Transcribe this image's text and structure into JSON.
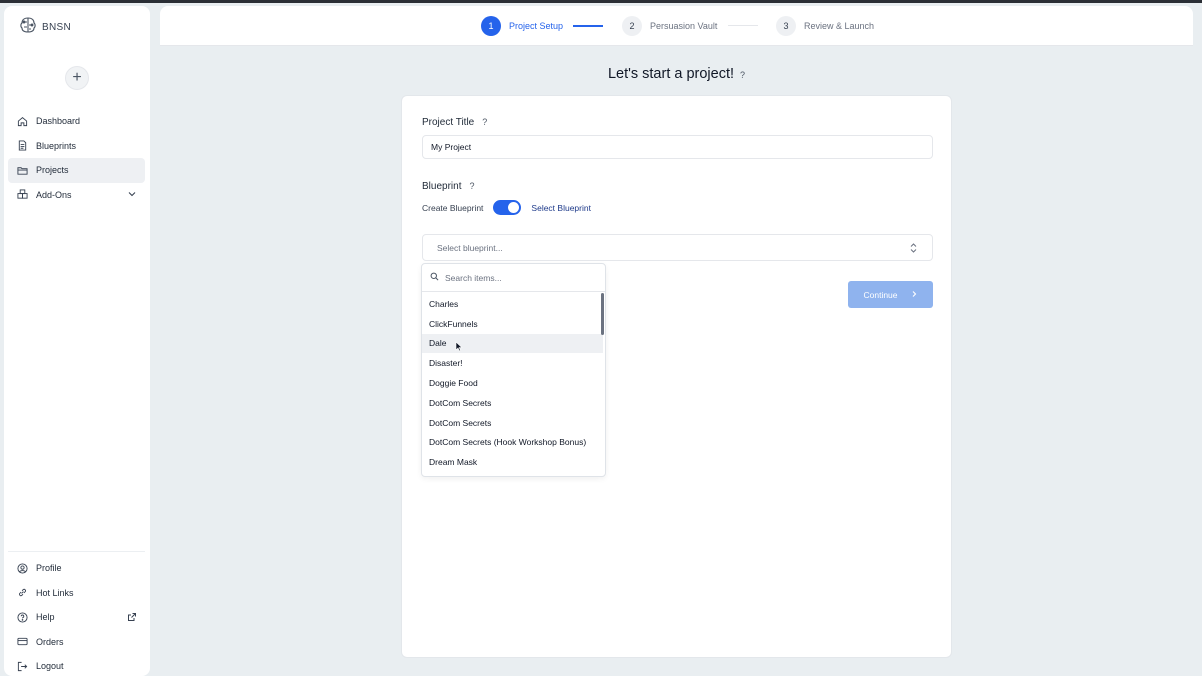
{
  "app": {
    "brand": "BNSN"
  },
  "sidebar": {
    "items": [
      {
        "label": "Dashboard",
        "icon": "home-icon"
      },
      {
        "label": "Blueprints",
        "icon": "document-icon"
      },
      {
        "label": "Projects",
        "icon": "folder-icon",
        "active": true
      },
      {
        "label": "Add-Ons",
        "icon": "addons-icon",
        "trailing": "chevron-down-icon"
      }
    ],
    "bottom_items": [
      {
        "label": "Profile",
        "icon": "user-icon"
      },
      {
        "label": "Hot Links",
        "icon": "link-icon"
      },
      {
        "label": "Help",
        "icon": "help-icon",
        "trailing": "external-link-icon"
      },
      {
        "label": "Orders",
        "icon": "card-icon"
      },
      {
        "label": "Logout",
        "icon": "logout-icon"
      }
    ]
  },
  "stepper": {
    "steps": [
      {
        "num": "1",
        "label": "Project Setup",
        "active": true
      },
      {
        "num": "2",
        "label": "Persuasion Vault",
        "active": false
      },
      {
        "num": "3",
        "label": "Review & Launch",
        "active": false
      }
    ]
  },
  "page": {
    "title": "Let's start a project!",
    "help": "?"
  },
  "form": {
    "project_title_label": "Project Title",
    "project_title_value": "My Project",
    "blueprint_label": "Blueprint",
    "help": "?",
    "toggle_left": "Create Blueprint",
    "toggle_right": "Select Blueprint",
    "select_placeholder": "Select blueprint...",
    "continue_label": "Continue"
  },
  "dropdown": {
    "search_placeholder": "Search items...",
    "items": [
      "Charles",
      "ClickFunnels",
      "Dale",
      "Disaster!",
      "Doggie Food",
      "DotCom Secrets",
      "DotCom Secrets",
      "DotCom Secrets (Hook Workshop Bonus)",
      "Dream Mask"
    ],
    "hovered_index": 2
  },
  "colors": {
    "accent": "#2563eb",
    "continue_disabled": "#8fb3ee",
    "background": "#e9eef1"
  }
}
